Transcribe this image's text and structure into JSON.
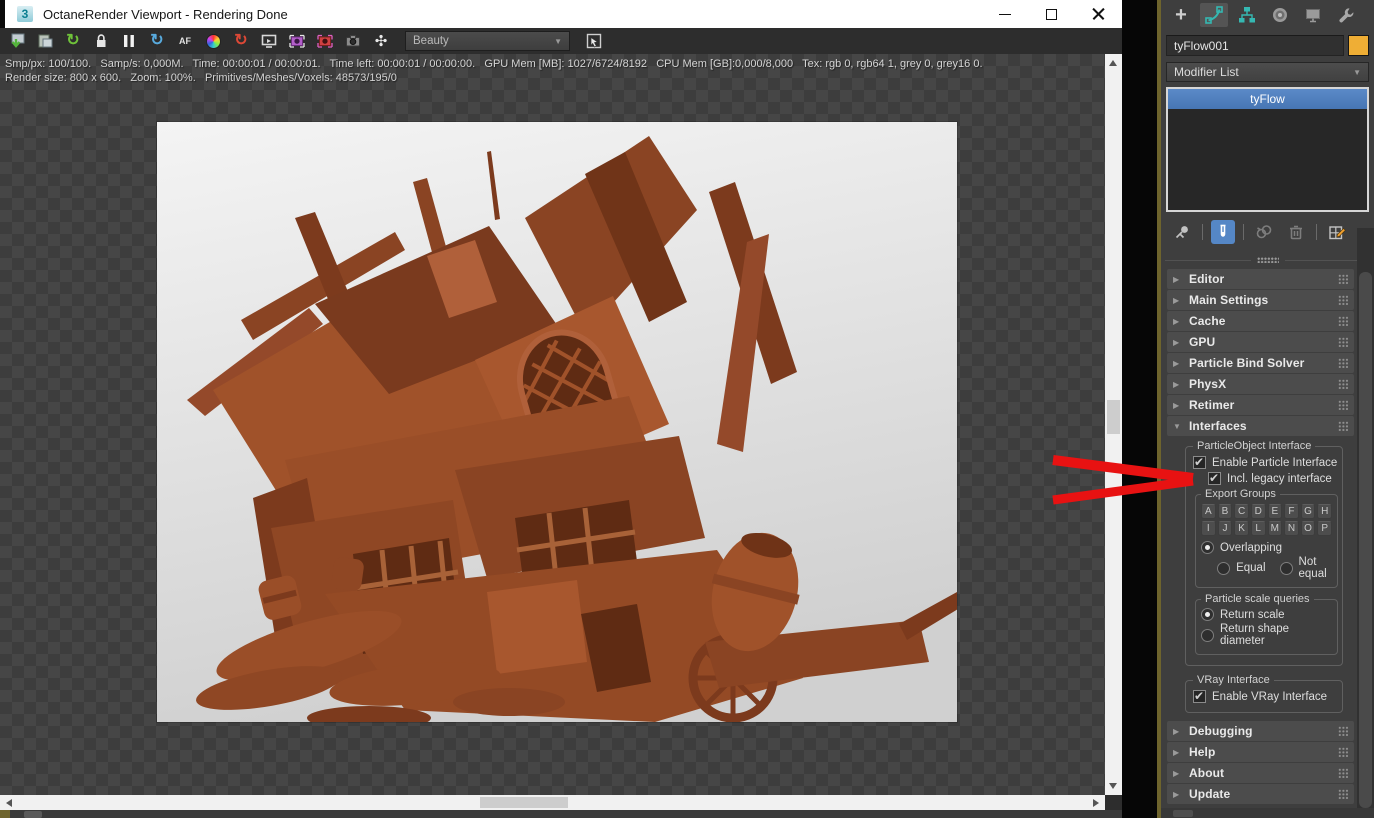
{
  "window": {
    "app_icon_glyph": "3",
    "title": "OctaneRender Viewport - Rendering Done"
  },
  "toolbar": {
    "af_label": "AF",
    "render_pass_value": "Beauty",
    "icons": [
      "save-image-icon",
      "copy-image-icon",
      "restart-render-icon",
      "lock-icon",
      "pause-icon",
      "refresh-icon",
      "autofocus-icon",
      "color-wheel-icon",
      "region-refresh-icon",
      "monitor-icon",
      "purple-camera-icon",
      "red-camera-icon",
      "camera-icon",
      "shutter-icon",
      "picker-icon"
    ]
  },
  "status": {
    "line1": "Smp/px: 100/100.   Samp/s: 0,000M.   Time: 00:00:01 / 00:00:01.   Time left: 00:00:01 / 00:00:00.   GPU Mem [MB]: 1027/6724/8192   CPU Mem [GB]:0,000/8,000   Tex: rgb 0, rgb64 1, grey 0, grey16 0.",
    "line2": "Render size: 800 x 600.   Zoom: 100%.   Primitives/Meshes/Voxels: 48573/195/0"
  },
  "render": {
    "subject": "clay render of collapsed wooden house with cart",
    "clay_color": "#a0522a",
    "background_top": "#f4f4f4",
    "background_bottom": "#d0d0d0"
  },
  "command_panel": {
    "object_name": "tyFlow001",
    "object_color": "#efae35",
    "modifier_list_label": "Modifier List",
    "modifier_stack": [
      {
        "label": "tyFlow",
        "selected": true
      }
    ],
    "rollouts_top": [
      {
        "label": "Editor"
      },
      {
        "label": "Main Settings"
      },
      {
        "label": "Cache"
      },
      {
        "label": "GPU"
      },
      {
        "label": "Particle Bind Solver"
      },
      {
        "label": "PhysX"
      },
      {
        "label": "Retimer"
      }
    ],
    "interfaces_rollout": {
      "label": "Interfaces",
      "expanded": true,
      "particleobject_group": {
        "title": "ParticleObject Interface",
        "enable_particle": {
          "label": "Enable Particle Interface",
          "checked": true
        },
        "incl_legacy": {
          "label": "Incl. legacy interface",
          "checked": true
        },
        "export_groups": {
          "title": "Export Groups",
          "letters": [
            "A",
            "B",
            "C",
            "D",
            "E",
            "F",
            "G",
            "H",
            "I",
            "J",
            "K",
            "L",
            "M",
            "N",
            "O",
            "P"
          ],
          "modes": [
            {
              "label": "Overlapping",
              "selected": true
            },
            {
              "label": "Equal",
              "selected": false
            },
            {
              "label": "Not equal",
              "selected": false
            }
          ]
        },
        "scale_queries": {
          "title": "Particle scale queries",
          "options": [
            {
              "label": "Return scale",
              "selected": true
            },
            {
              "label": "Return shape diameter",
              "selected": false
            }
          ]
        }
      },
      "vray_group": {
        "title": "VRay Interface",
        "enable_vray": {
          "label": "Enable VRay Interface",
          "checked": true
        }
      }
    },
    "rollouts_bottom": [
      {
        "label": "Debugging"
      },
      {
        "label": "Help"
      },
      {
        "label": "About"
      },
      {
        "label": "Update"
      }
    ]
  },
  "annotation": {
    "arrow_color": "#e81212",
    "target": "Enable Particle Interface"
  }
}
